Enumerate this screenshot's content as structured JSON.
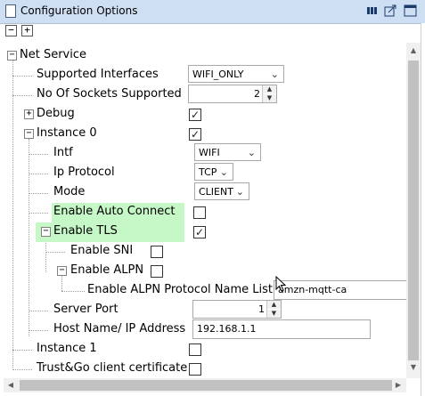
{
  "window": {
    "title": "Configuration Options"
  },
  "toolbar": {
    "collapse_label": "−",
    "expand_label": "+"
  },
  "tree": {
    "net_service": "Net Service",
    "supported_interfaces": {
      "label": "Supported Interfaces",
      "value": "WIFI_ONLY"
    },
    "no_of_sockets": {
      "label": "No Of Sockets Supported",
      "value": "2"
    },
    "debug": {
      "label": "Debug",
      "checked": true
    },
    "instance0": {
      "label": "Instance 0",
      "checked": true
    },
    "intf": {
      "label": "Intf",
      "value": "WIFI"
    },
    "ip_protocol": {
      "label": "Ip Protocol",
      "value": "TCP"
    },
    "mode": {
      "label": "Mode",
      "value": "CLIENT"
    },
    "enable_auto_connect": {
      "label": "Enable Auto Connect",
      "checked": false
    },
    "enable_tls": {
      "label": "Enable TLS",
      "checked": true
    },
    "enable_sni": {
      "label": "Enable SNI",
      "checked": false
    },
    "enable_alpn": {
      "label": "Enable ALPN",
      "checked": false
    },
    "alpn_protocol_name_list": {
      "label": "Enable ALPN Protocol Name List",
      "value": "amzn-mqtt-ca"
    },
    "server_port": {
      "label": "Server Port",
      "value": "1"
    },
    "host_name": {
      "label": "Host Name/ IP Address",
      "value": "192.168.1.1"
    },
    "instance1": {
      "label": "Instance 1",
      "checked": false
    },
    "trust_go": {
      "label": "Trust&Go client certificate",
      "checked": false
    }
  },
  "glyphs": {
    "expanded": "−",
    "collapsed": "+",
    "check": "✓",
    "chevron": "⌄",
    "up": "▲",
    "down": "▼",
    "left": "◀",
    "right": "▶"
  }
}
